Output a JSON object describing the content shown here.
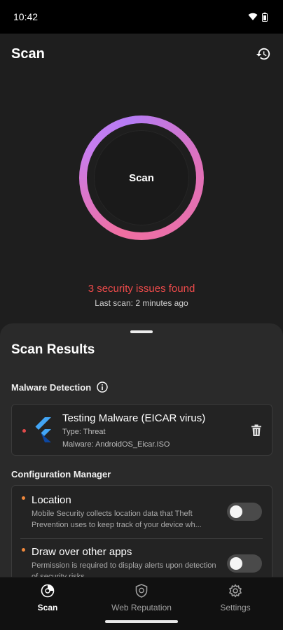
{
  "status_bar": {
    "time": "10:42"
  },
  "app_bar": {
    "title": "Scan"
  },
  "scan": {
    "button_label": "Scan",
    "issues_text": "3 security issues found",
    "last_scan": "Last scan: 2 minutes ago"
  },
  "results": {
    "title": "Scan Results",
    "malware_section": {
      "title": "Malware Detection",
      "item": {
        "title": "Testing Malware (EICAR virus)",
        "type": "Type: Threat",
        "malware": "Malware: AndroidOS_Eicar.ISO"
      }
    },
    "config_section": {
      "title": "Configuration Manager",
      "items": [
        {
          "title": "Location",
          "description": "Mobile Security collects location data that Theft Prevention uses to keep track of your device wh...",
          "enabled": false
        },
        {
          "title": "Draw over other apps",
          "description": "Permission is required to display alerts upon detection of security risks",
          "enabled": false
        }
      ]
    }
  },
  "bottom_nav": {
    "items": [
      {
        "label": "Scan",
        "icon": "scan-icon",
        "active": true
      },
      {
        "label": "Web Reputation",
        "icon": "shield-icon",
        "active": false
      },
      {
        "label": "Settings",
        "icon": "gear-icon",
        "active": false
      }
    ]
  },
  "colors": {
    "issues": "#ef4b4b",
    "ring_start": "#f06fa1",
    "ring_end": "#b57cf4",
    "bullet_red": "#e24a4a",
    "bullet_orange": "#f0883c"
  }
}
